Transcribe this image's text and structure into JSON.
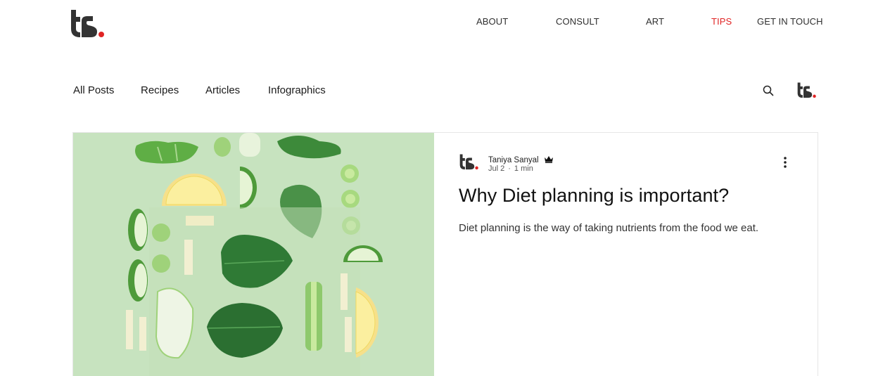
{
  "site": {
    "logo_icon": "ts-logo-icon",
    "brand_colors": {
      "accent": "#e02424",
      "logo_dark": "#333333"
    }
  },
  "top_nav": {
    "items": [
      {
        "label": "ABOUT",
        "active": false
      },
      {
        "label": "CONSULT",
        "active": false
      },
      {
        "label": "ART",
        "active": false
      },
      {
        "label": "TIPS",
        "active": true
      },
      {
        "label": "GET IN TOUCH",
        "active": false
      }
    ]
  },
  "blog_nav": {
    "categories": [
      {
        "label": "All Posts"
      },
      {
        "label": "Recipes"
      },
      {
        "label": "Articles"
      },
      {
        "label": "Infographics"
      }
    ],
    "search_icon": "search-icon",
    "profile_icon": "ts-logo-icon"
  },
  "post": {
    "image_description_icon": "vegetables-flatlay-image",
    "author": "Taniya Sanyal",
    "author_badge_icon": "crown-icon",
    "date": "Jul 2",
    "separator": "·",
    "read_time": "1 min",
    "title": "Why Diet planning is important?",
    "excerpt": "Diet planning is the way of taking nutrients from the food we eat.",
    "more_icon": "more-vertical-icon"
  }
}
